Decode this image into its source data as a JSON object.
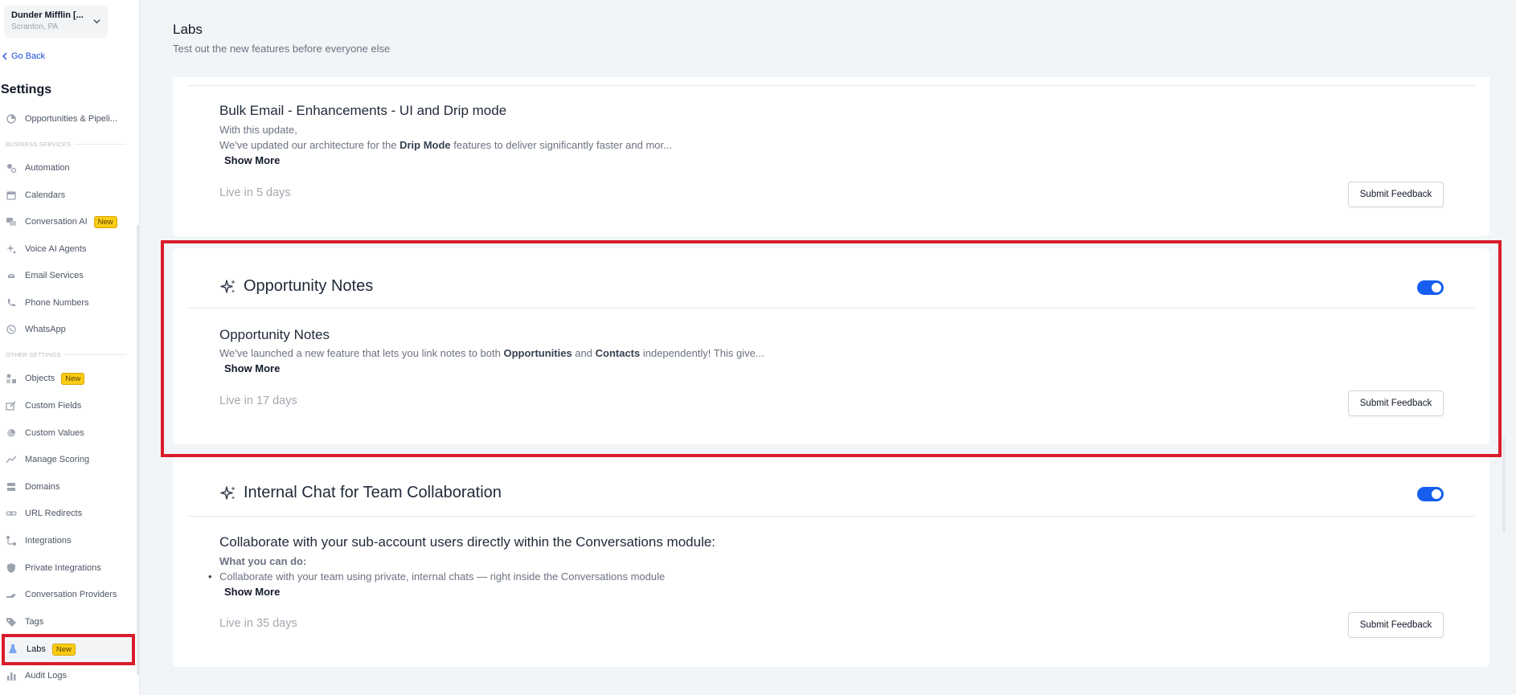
{
  "account": {
    "name": "Dunder Mifflin [...",
    "location": "Scranton, PA"
  },
  "nav": {
    "go_back": "Go Back",
    "settings_title": "Settings"
  },
  "sidebar": {
    "top_item": "Opportunities & Pipeli...",
    "section_business": "BUSINESS SERVICES",
    "business_items": [
      "Automation",
      "Calendars",
      "Conversation AI",
      "Voice AI Agents",
      "Email Services",
      "Phone Numbers",
      "WhatsApp"
    ],
    "section_other": "OTHER SETTINGS",
    "other_items": [
      "Objects",
      "Custom Fields",
      "Custom Values",
      "Manage Scoring",
      "Domains",
      "URL Redirects",
      "Integrations",
      "Private Integrations",
      "Conversation Providers",
      "Tags",
      "Labs",
      "Audit Logs"
    ],
    "badge_new": "New"
  },
  "page": {
    "title": "Labs",
    "subtitle": "Test out the new features before everyone else"
  },
  "features": [
    {
      "subtitle": "Bulk Email - Enhancements - UI and Drip mode",
      "desc_line1": "With this update,",
      "desc_pre": "We've updated our architecture for the ",
      "desc_bold": "Drip Mode",
      "desc_post": " features to deliver significantly faster and mor...",
      "show_more": "Show More",
      "live": "Live in 5 days",
      "feedback": "Submit Feedback"
    },
    {
      "title": "Opportunity Notes",
      "enabled": true,
      "subtitle": "Opportunity Notes",
      "desc_pre": "We've launched a new feature that lets you link notes to both ",
      "desc_bold1": "Opportunities",
      "desc_mid": " and ",
      "desc_bold2": "Contacts",
      "desc_post": " independently! This give...",
      "show_more": "Show More",
      "live": "Live in 17 days",
      "feedback": "Submit Feedback"
    },
    {
      "title": "Internal Chat for Team Collaboration",
      "enabled": true,
      "subtitle": "Collaborate with your sub-account users directly within the Conversations module:",
      "what_label": "What you can do:",
      "bullet": "Collaborate with your team using private, internal chats — right inside the Conversations module",
      "show_more": "Show More",
      "live": "Live in 35 days",
      "feedback": "Submit Feedback"
    }
  ],
  "colors": {
    "accent": "#155eef",
    "highlight": "#d91c2b",
    "badge": "#facc15"
  }
}
